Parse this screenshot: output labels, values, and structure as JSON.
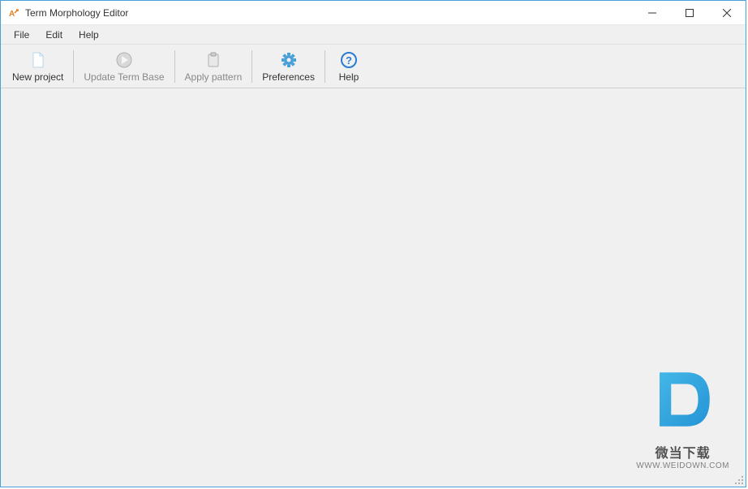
{
  "titlebar": {
    "title": "Term Morphology Editor"
  },
  "menubar": {
    "items": [
      {
        "label": "File"
      },
      {
        "label": "Edit"
      },
      {
        "label": "Help"
      }
    ]
  },
  "toolbar": {
    "new_project": "New project",
    "update_term_base": "Update Term Base",
    "apply_pattern": "Apply pattern",
    "preferences": "Preferences",
    "help": "Help"
  },
  "watermark": {
    "line1": "微当下载",
    "line2": "WWW.WEIDOWN.COM"
  }
}
